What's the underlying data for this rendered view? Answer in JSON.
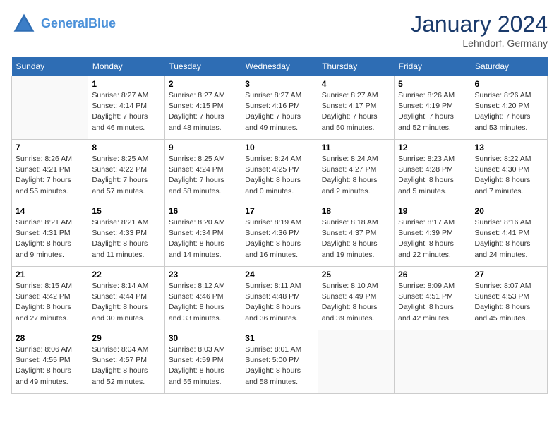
{
  "header": {
    "logo_line1": "General",
    "logo_line2": "Blue",
    "month": "January 2024",
    "location": "Lehndorf, Germany"
  },
  "weekdays": [
    "Sunday",
    "Monday",
    "Tuesday",
    "Wednesday",
    "Thursday",
    "Friday",
    "Saturday"
  ],
  "weeks": [
    [
      {
        "day": null,
        "sunrise": null,
        "sunset": null,
        "daylight": null
      },
      {
        "day": "1",
        "sunrise": "8:27 AM",
        "sunset": "4:14 PM",
        "daylight": "7 hours and 46 minutes."
      },
      {
        "day": "2",
        "sunrise": "8:27 AM",
        "sunset": "4:15 PM",
        "daylight": "7 hours and 48 minutes."
      },
      {
        "day": "3",
        "sunrise": "8:27 AM",
        "sunset": "4:16 PM",
        "daylight": "7 hours and 49 minutes."
      },
      {
        "day": "4",
        "sunrise": "8:27 AM",
        "sunset": "4:17 PM",
        "daylight": "7 hours and 50 minutes."
      },
      {
        "day": "5",
        "sunrise": "8:26 AM",
        "sunset": "4:19 PM",
        "daylight": "7 hours and 52 minutes."
      },
      {
        "day": "6",
        "sunrise": "8:26 AM",
        "sunset": "4:20 PM",
        "daylight": "7 hours and 53 minutes."
      }
    ],
    [
      {
        "day": "7",
        "sunrise": "8:26 AM",
        "sunset": "4:21 PM",
        "daylight": "7 hours and 55 minutes."
      },
      {
        "day": "8",
        "sunrise": "8:25 AM",
        "sunset": "4:22 PM",
        "daylight": "7 hours and 57 minutes."
      },
      {
        "day": "9",
        "sunrise": "8:25 AM",
        "sunset": "4:24 PM",
        "daylight": "7 hours and 58 minutes."
      },
      {
        "day": "10",
        "sunrise": "8:24 AM",
        "sunset": "4:25 PM",
        "daylight": "8 hours and 0 minutes."
      },
      {
        "day": "11",
        "sunrise": "8:24 AM",
        "sunset": "4:27 PM",
        "daylight": "8 hours and 2 minutes."
      },
      {
        "day": "12",
        "sunrise": "8:23 AM",
        "sunset": "4:28 PM",
        "daylight": "8 hours and 5 minutes."
      },
      {
        "day": "13",
        "sunrise": "8:22 AM",
        "sunset": "4:30 PM",
        "daylight": "8 hours and 7 minutes."
      }
    ],
    [
      {
        "day": "14",
        "sunrise": "8:21 AM",
        "sunset": "4:31 PM",
        "daylight": "8 hours and 9 minutes."
      },
      {
        "day": "15",
        "sunrise": "8:21 AM",
        "sunset": "4:33 PM",
        "daylight": "8 hours and 11 minutes."
      },
      {
        "day": "16",
        "sunrise": "8:20 AM",
        "sunset": "4:34 PM",
        "daylight": "8 hours and 14 minutes."
      },
      {
        "day": "17",
        "sunrise": "8:19 AM",
        "sunset": "4:36 PM",
        "daylight": "8 hours and 16 minutes."
      },
      {
        "day": "18",
        "sunrise": "8:18 AM",
        "sunset": "4:37 PM",
        "daylight": "8 hours and 19 minutes."
      },
      {
        "day": "19",
        "sunrise": "8:17 AM",
        "sunset": "4:39 PM",
        "daylight": "8 hours and 22 minutes."
      },
      {
        "day": "20",
        "sunrise": "8:16 AM",
        "sunset": "4:41 PM",
        "daylight": "8 hours and 24 minutes."
      }
    ],
    [
      {
        "day": "21",
        "sunrise": "8:15 AM",
        "sunset": "4:42 PM",
        "daylight": "8 hours and 27 minutes."
      },
      {
        "day": "22",
        "sunrise": "8:14 AM",
        "sunset": "4:44 PM",
        "daylight": "8 hours and 30 minutes."
      },
      {
        "day": "23",
        "sunrise": "8:12 AM",
        "sunset": "4:46 PM",
        "daylight": "8 hours and 33 minutes."
      },
      {
        "day": "24",
        "sunrise": "8:11 AM",
        "sunset": "4:48 PM",
        "daylight": "8 hours and 36 minutes."
      },
      {
        "day": "25",
        "sunrise": "8:10 AM",
        "sunset": "4:49 PM",
        "daylight": "8 hours and 39 minutes."
      },
      {
        "day": "26",
        "sunrise": "8:09 AM",
        "sunset": "4:51 PM",
        "daylight": "8 hours and 42 minutes."
      },
      {
        "day": "27",
        "sunrise": "8:07 AM",
        "sunset": "4:53 PM",
        "daylight": "8 hours and 45 minutes."
      }
    ],
    [
      {
        "day": "28",
        "sunrise": "8:06 AM",
        "sunset": "4:55 PM",
        "daylight": "8 hours and 49 minutes."
      },
      {
        "day": "29",
        "sunrise": "8:04 AM",
        "sunset": "4:57 PM",
        "daylight": "8 hours and 52 minutes."
      },
      {
        "day": "30",
        "sunrise": "8:03 AM",
        "sunset": "4:59 PM",
        "daylight": "8 hours and 55 minutes."
      },
      {
        "day": "31",
        "sunrise": "8:01 AM",
        "sunset": "5:00 PM",
        "daylight": "8 hours and 58 minutes."
      },
      {
        "day": null,
        "sunrise": null,
        "sunset": null,
        "daylight": null
      },
      {
        "day": null,
        "sunrise": null,
        "sunset": null,
        "daylight": null
      },
      {
        "day": null,
        "sunrise": null,
        "sunset": null,
        "daylight": null
      }
    ]
  ]
}
